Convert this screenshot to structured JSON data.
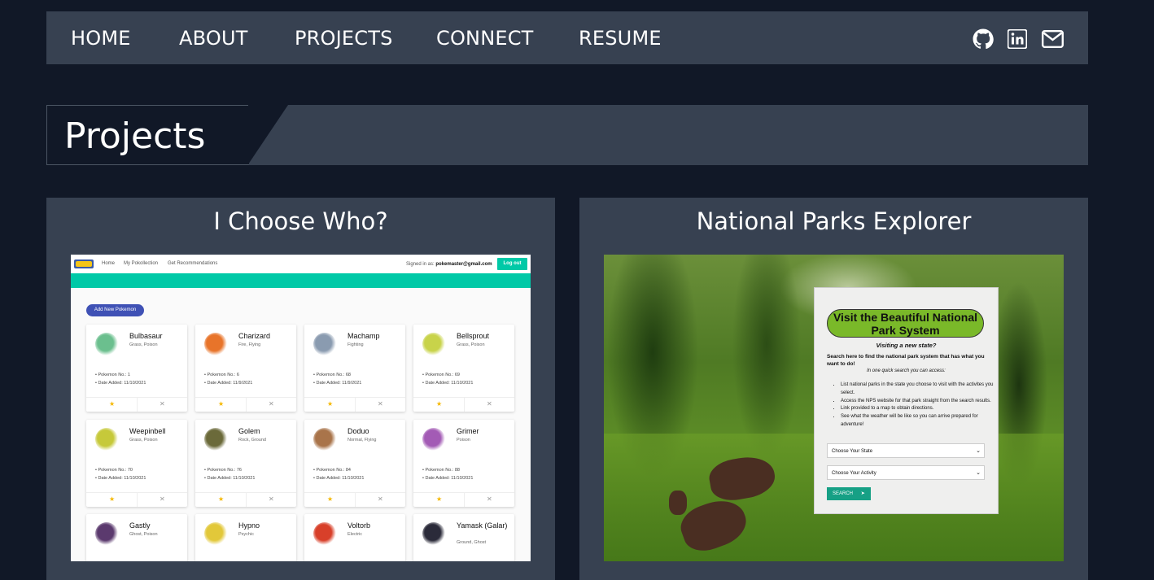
{
  "nav": {
    "links": [
      "HOME",
      "ABOUT",
      "PROJECTS",
      "CONNECT",
      "RESUME"
    ],
    "icons": [
      "github-icon",
      "linkedin-icon",
      "mail-icon"
    ]
  },
  "banner": {
    "title": "Projects"
  },
  "projects": [
    {
      "title": "I Choose Who?"
    },
    {
      "title": "National Parks Explorer"
    }
  ],
  "poke_app": {
    "nav": [
      "Home",
      "My Pokollection",
      "Get Recommendations"
    ],
    "signed_in_label": "Signed in as:",
    "user_email": "pokemaster@gmail.com",
    "logout": "Log out",
    "add_button": "Add New Pokemon",
    "cards": [
      {
        "name": "Bulbasaur",
        "type": "Grass, Poison",
        "no": "Pokemon No.: 1",
        "date": "Date Added: 11/10/2021",
        "color": "#6bbf8e"
      },
      {
        "name": "Charizard",
        "type": "Fire, Flying",
        "no": "Pokemon No.: 6",
        "date": "Date Added: 11/9/2021",
        "color": "#e8742a"
      },
      {
        "name": "Machamp",
        "type": "Fighting",
        "no": "Pokemon No.: 68",
        "date": "Date Added: 11/9/2021",
        "color": "#8a9bb0"
      },
      {
        "name": "Bellsprout",
        "type": "Grass, Poison",
        "no": "Pokemon No.: 69",
        "date": "Date Added: 11/10/2021",
        "color": "#c8d34a"
      },
      {
        "name": "Weepinbell",
        "type": "Grass, Poison",
        "no": "Pokemon No.: 70",
        "date": "Date Added: 11/10/2021",
        "color": "#c6c93a"
      },
      {
        "name": "Golem",
        "type": "Rock, Ground",
        "no": "Pokemon No.: 76",
        "date": "Date Added: 11/10/2021",
        "color": "#6b6a3a"
      },
      {
        "name": "Doduo",
        "type": "Normal, Flying",
        "no": "Pokemon No.: 84",
        "date": "Date Added: 11/10/2021",
        "color": "#a9744a"
      },
      {
        "name": "Grimer",
        "type": "Poison",
        "no": "Pokemon No.: 88",
        "date": "Date Added: 11/10/2021",
        "color": "#a35bb5"
      },
      {
        "name": "Gastly",
        "type": "Ghost, Poison",
        "no": "",
        "date": "",
        "color": "#5b3a6e"
      },
      {
        "name": "Hypno",
        "type": "Psychic",
        "no": "",
        "date": "",
        "color": "#e2c83a"
      },
      {
        "name": "Voltorb",
        "type": "Electric",
        "no": "",
        "date": "",
        "color": "#d8402a"
      },
      {
        "name": "Yamask (Galar)",
        "type": "Ground, Ghost",
        "no": "",
        "date": "",
        "color": "#2b2b3a"
      }
    ],
    "star": "★",
    "remove": "✕"
  },
  "parks_app": {
    "headline": "Visit the Beautiful National Park System",
    "question": "Visiting a new state?",
    "subhead": "Search here to find the national park system that has what you want to do!",
    "intro": "In one quick search you can access:",
    "bullets": [
      "List national parks in the state you choose to visit with the activites you select.",
      "Access the NPS website for that park straight from the search results.",
      "Link provided to a map to obtain directions.",
      "See what the weather will be like so you can arrive prepared for adventure!"
    ],
    "state_select": "Choose Your State",
    "activity_select": "Choose Your Activity",
    "search_button": "SEARCH"
  }
}
